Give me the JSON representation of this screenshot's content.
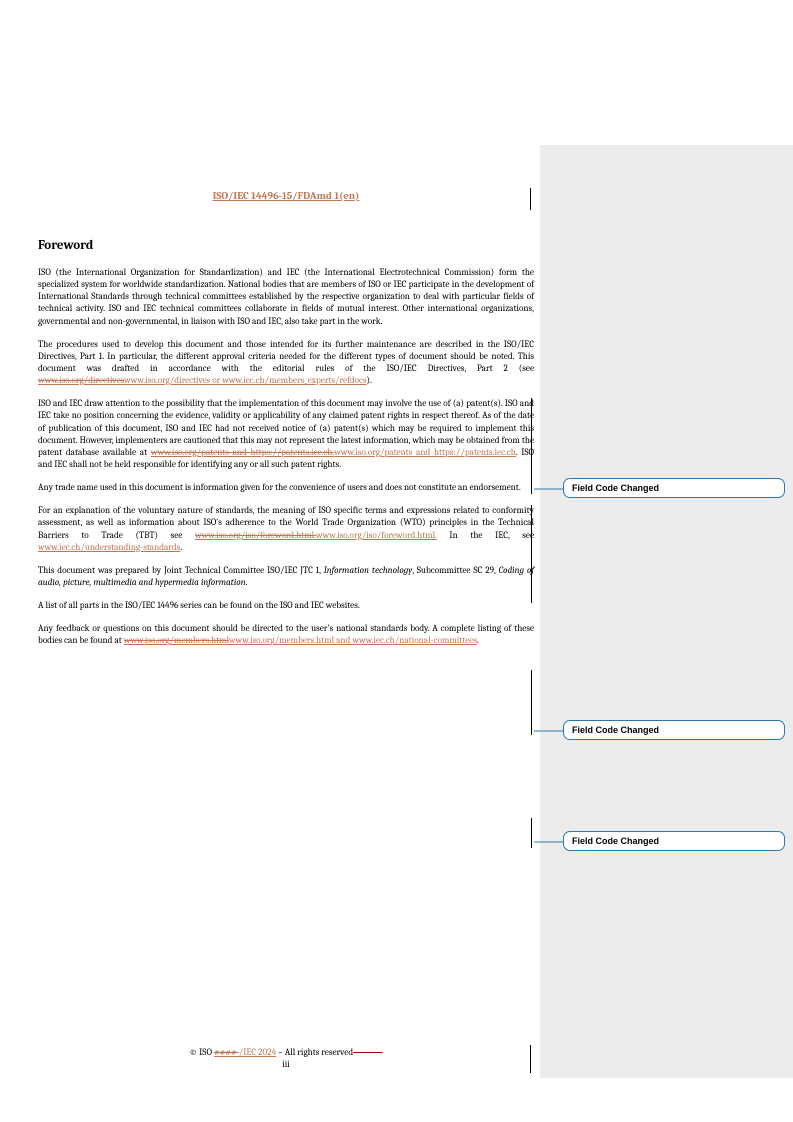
{
  "header": {
    "doc_id": "ISO/IEC 14496-15/FDAmd 1(en)"
  },
  "foreword_heading": "Foreword",
  "para1": "ISO (the International Organization for Standardization) and IEC (the International Electrotechnical Commission) form the specialized system for worldwide standardization. National bodies that are members of ISO or IEC participate in the development of International Standards through technical committees established by the respective organization to deal with particular fields of technical activity. ISO and IEC technical committees collaborate in fields of mutual interest. Other international organizations, governmental and non-governmental, in liaison with ISO and IEC, also take part in the work.",
  "para2_a": "The procedures used to develop this document and those intended for its further maintenance are described in the ISO/IEC Directives, Part 1. In particular, the different approval criteria needed for the different types of document should be noted. This document was drafted in accordance with the editorial rules of the ISO/IEC Directives, Part 2 (see ",
  "para2_del": "www.iso.org/directives",
  "para2_ins1": "www.iso.org/directives",
  "para2_or": " or ",
  "para2_ins2": "www.iec.ch/members_experts/refdocs",
  "para2_close": ").",
  "para3_a": "ISO and IEC draw attention to the possibility that the implementation of this document may involve the use of (a) patent(s). ISO and IEC take no position concerning the evidence, validity or applicability of any claimed patent rights in respect thereof. As of the date of publication of this document, ISO and IEC had not received notice of (a) patent(s) which may be required to implement this document. However, implementers are cautioned that this may not represent the latest information, which may be obtained from the patent database available at ",
  "para3_del": "www.iso.org/patents and https://patents.iec.ch.",
  "para3_ins": "www.iso.org/patents and https://patents.iec.ch",
  "para3_b": ". ISO and IEC shall not be held responsible for identifying any or all such patent rights.",
  "para4": "Any trade name used in this document is information given for the convenience of users and does not constitute an endorsement.",
  "para5_a": "For an explanation of the voluntary nature of standards, the meaning of ISO specific terms and expressions related to conformity assessment, as well as information about ISO's adherence to the World Trade Organization (WTO) principles in the Technical Barriers to Trade (TBT) see ",
  "para5_del": "www.iso.org/iso/foreword.html.",
  "para5_ins1": "www.iso.org/iso/foreword.html.",
  "para5_mid": " In the IEC, see ",
  "para5_ins2": "www.iec.ch/understanding-standards",
  "para5_close": ".",
  "para6_a": "This document was prepared by Joint Technical Committee ISO/IEC JTC 1, ",
  "para6_it1": "Information technology",
  "para6_b": ", Subcommittee SC 29, ",
  "para6_it2": "Coding of audio, picture, multimedia and hypermedia information",
  "para6_c": ".",
  "para7": "A list of all parts in the ISO/IEC 14496 series can be found on the ISO and IEC websites.",
  "para8_a": "Any feedback or questions on this document should be directed to the user's national standards body. A complete listing of these bodies can be found at ",
  "para8_del": "www.iso.org/members.html",
  "para8_ins1": "www.iso.org/members.html",
  "para8_and": " and ",
  "para8_ins2": "www.iec.ch/national-committees",
  "para8_close": ".",
  "footer": {
    "pre": "© ISO ",
    "del_year": "#### ",
    "ins_org": "/IEC 2024",
    "post": " – All rights reserved",
    "trailing_dash": " ———",
    "page": "iii"
  },
  "callouts": {
    "c1": "Field Code Changed",
    "c2": "Field Code Changed",
    "c3": "Field Code Changed"
  }
}
